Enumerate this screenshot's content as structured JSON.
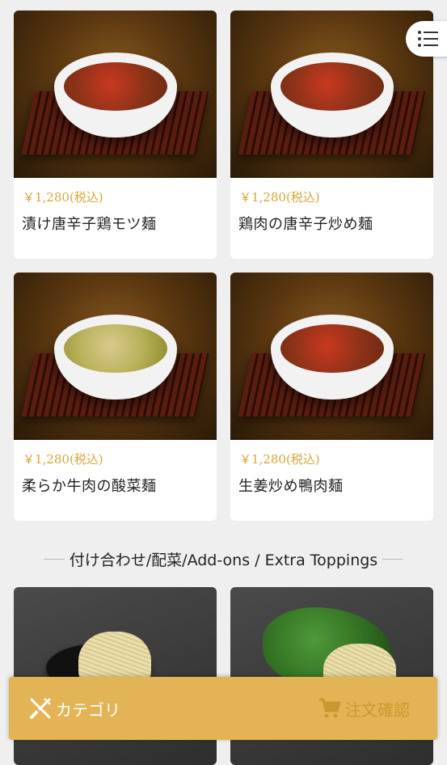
{
  "products": [
    {
      "price": "￥1,280(税込)",
      "name": "漬け唐辛子鶏モツ麺"
    },
    {
      "price": "￥1,280(税込)",
      "name": "鶏肉の唐辛子炒め麺"
    },
    {
      "price": "￥1,280(税込)",
      "name": "柔らか牛肉の酸菜麺"
    },
    {
      "price": "￥1,280(税込)",
      "name": "生姜炒め鴨肉麺"
    }
  ],
  "section": {
    "title": "付け合わせ/配菜/Add-ons / Extra Toppings"
  },
  "bottom_bar": {
    "category_label": "カテゴリ",
    "order_label": "注文確認"
  },
  "icons": {
    "menu": "list-icon",
    "category": "fork-knife-icon",
    "order": "cart-icon"
  },
  "colors": {
    "accent": "#e3b455",
    "price": "#d9a43a"
  }
}
